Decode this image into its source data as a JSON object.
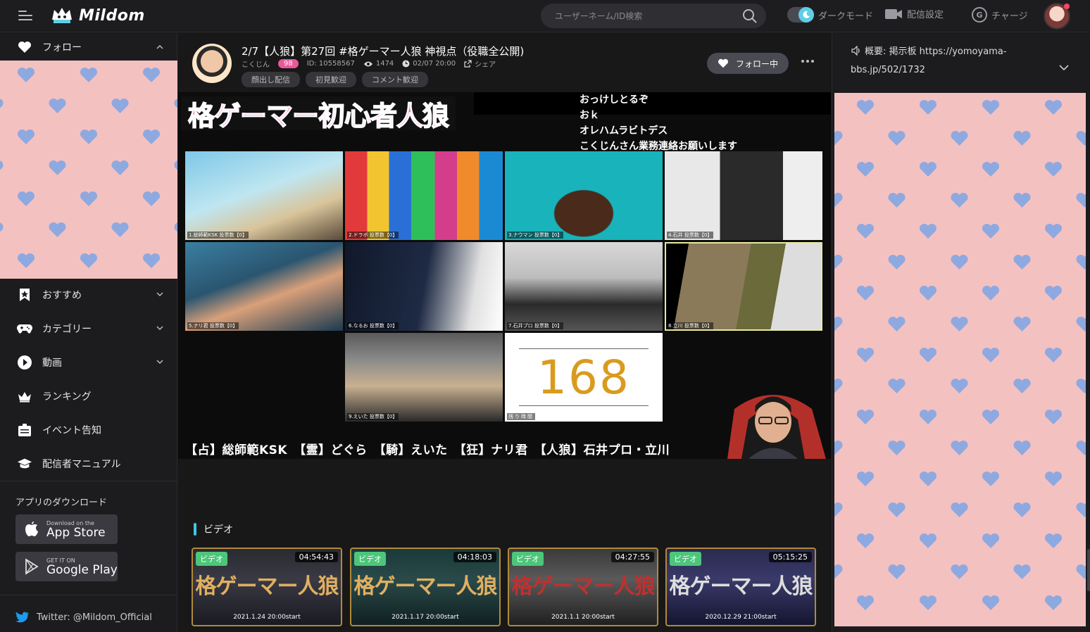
{
  "header": {
    "logo_text": "Mildom",
    "search_placeholder": "ユーザーネーム/ID検索",
    "dark_mode_label": "ダークモード",
    "stream_settings_label": "配信設定",
    "charge_label": "チャージ"
  },
  "sidebar": {
    "follow_label": "フォロー",
    "items": [
      {
        "label": "おすすめ"
      },
      {
        "label": "カテゴリー"
      },
      {
        "label": "動画"
      },
      {
        "label": "ランキング"
      },
      {
        "label": "イベント告知"
      },
      {
        "label": "配信者マニュアル"
      }
    ],
    "download_title": "アプリのダウンロード",
    "app_store": {
      "small": "Download on the",
      "big": "App Store"
    },
    "google_play": {
      "small": "GET IT ON",
      "big": "Google Play"
    },
    "twitter": "Twitter: @Mildom_Official"
  },
  "stream": {
    "title": "2/7【人狼】第27回 #格ゲーマー人狼 神視点（役職全公開)",
    "channel_name": "こくじん",
    "level": "98",
    "id": "ID: 10558567",
    "viewers": "1474",
    "time": "02/07 20:00",
    "share": "シェア",
    "tags": [
      "顔出し配信",
      "初見歓迎",
      "コメント歓迎"
    ],
    "follow_label": "フォロー中"
  },
  "video": {
    "banner": "格ゲーマー初心者人狼",
    "chat": [
      "おっけしとるぞ",
      "おｋ",
      "オレハムラビトデス",
      "こくじんさん業務連絡お願いします"
    ],
    "tiles": [
      {
        "name": "1.総師範KSK 投票数【0】"
      },
      {
        "name": "2.ドラボ 投票数【0】"
      },
      {
        "name": "3.ナウマン 投票数【0】"
      },
      {
        "name": "4.石井 投票数【0】"
      },
      {
        "name": "5.ナリ君 投票数【0】"
      },
      {
        "name": "6.なるお 投票数【0】"
      },
      {
        "name": "7.石井プロ 投票数【0】"
      },
      {
        "name": "8.立川 投票数【0】"
      },
      {
        "name": "9.えいた 投票数【0】"
      },
      {
        "name": "残り時間"
      }
    ],
    "timer": "168",
    "roles": "【占】総師範KSK　【霊】どぐら　【騎】えいた　【狂】ナリ君　【人狼】石井プロ・立川"
  },
  "videos_section": {
    "title": "ビデオ",
    "cards": [
      {
        "badge": "ビデオ",
        "duration": "04:54:43",
        "title": "格ゲーマー人狼",
        "date": "2021.1.24 20:00start"
      },
      {
        "badge": "ビデオ",
        "duration": "04:18:03",
        "title": "格ゲーマー人狼",
        "date": "2021.1.17 20:00start"
      },
      {
        "badge": "ビデオ",
        "duration": "04:27:55",
        "title": "格ゲーマー人狼",
        "date": "2021.1.1 20:00start"
      },
      {
        "badge": "ビデオ",
        "duration": "05:15:25",
        "title": "格ゲーマー人狼",
        "date": "2020.12.29 21:00start"
      }
    ]
  },
  "right_panel": {
    "notice": "概要: 掲示板 https://yomoyama-bbs.jp/502/1732"
  },
  "colors": {
    "accent": "#3fc6e6",
    "heart_bg": "#f4c1c1",
    "heart": "#8ea9e0",
    "level_badge": "#e85a9a",
    "video_badge": "#4cc67a"
  }
}
